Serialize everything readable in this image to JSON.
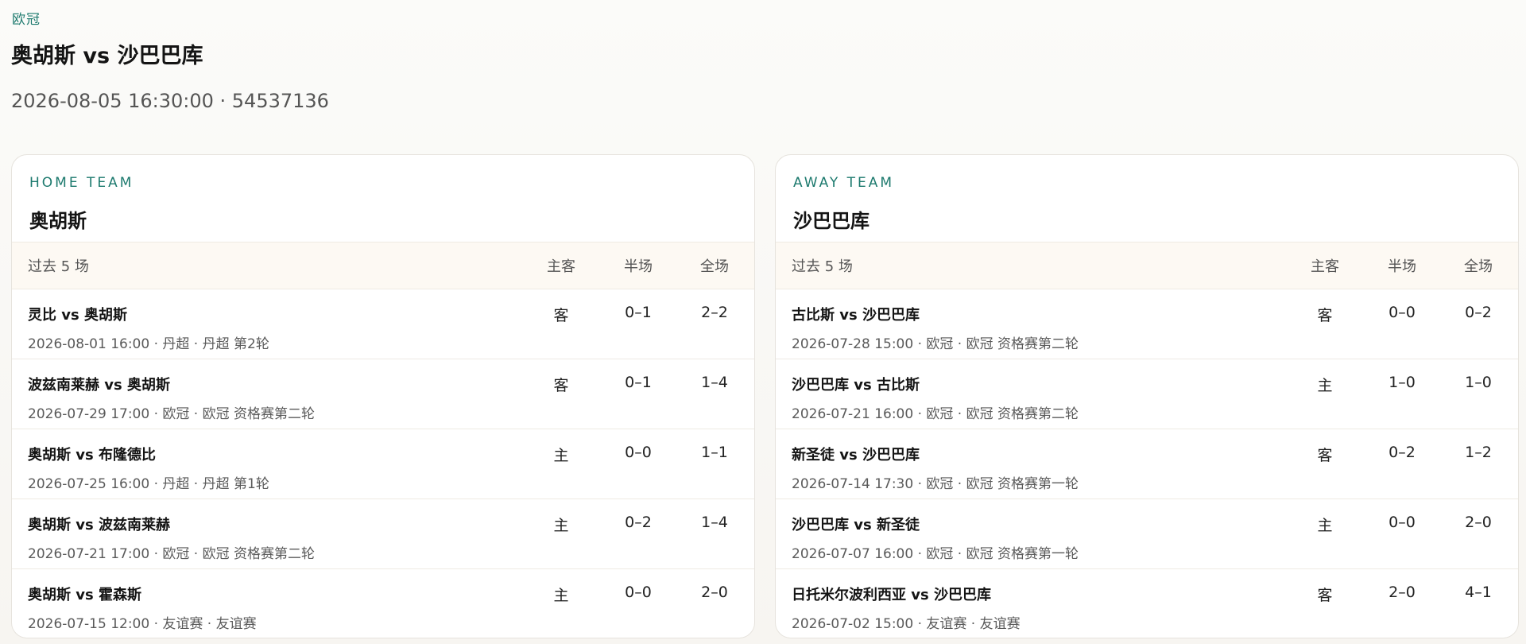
{
  "league": "欧冠",
  "match": {
    "title": "奥胡斯 vs 沙巴巴库",
    "meta": "2026-08-05 16:30:00 · 54537136"
  },
  "columns": {
    "title": "过去 5 场",
    "ha": "主客",
    "half": "半场",
    "full": "全场"
  },
  "home": {
    "role": "HOME TEAM",
    "name": "奥胡斯",
    "rows": [
      {
        "title": "灵比 vs 奥胡斯",
        "sub": "2026-08-01 16:00 · 丹超 · 丹超 第2轮",
        "ha": "客",
        "half": "0–1",
        "full": "2–2"
      },
      {
        "title": "波兹南莱赫 vs 奥胡斯",
        "sub": "2026-07-29 17:00 · 欧冠 · 欧冠 资格赛第二轮",
        "ha": "客",
        "half": "0–1",
        "full": "1–4"
      },
      {
        "title": "奥胡斯 vs 布隆德比",
        "sub": "2026-07-25 16:00 · 丹超 · 丹超 第1轮",
        "ha": "主",
        "half": "0–0",
        "full": "1–1"
      },
      {
        "title": "奥胡斯 vs 波兹南莱赫",
        "sub": "2026-07-21 17:00 · 欧冠 · 欧冠 资格赛第二轮",
        "ha": "主",
        "half": "0–2",
        "full": "1–4"
      },
      {
        "title": "奥胡斯 vs 霍森斯",
        "sub": "2026-07-15 12:00 · 友谊赛 · 友谊赛",
        "ha": "主",
        "half": "0–0",
        "full": "2–0"
      }
    ]
  },
  "away": {
    "role": "AWAY TEAM",
    "name": "沙巴巴库",
    "rows": [
      {
        "title": "古比斯 vs 沙巴巴库",
        "sub": "2026-07-28 15:00 · 欧冠 · 欧冠 资格赛第二轮",
        "ha": "客",
        "half": "0–0",
        "full": "0–2"
      },
      {
        "title": "沙巴巴库 vs 古比斯",
        "sub": "2026-07-21 16:00 · 欧冠 · 欧冠 资格赛第二轮",
        "ha": "主",
        "half": "1–0",
        "full": "1–0"
      },
      {
        "title": "新圣徒 vs 沙巴巴库",
        "sub": "2026-07-14 17:30 · 欧冠 · 欧冠 资格赛第一轮",
        "ha": "客",
        "half": "0–2",
        "full": "1–2"
      },
      {
        "title": "沙巴巴库 vs 新圣徒",
        "sub": "2026-07-07 16:00 · 欧冠 · 欧冠 资格赛第一轮",
        "ha": "主",
        "half": "0–0",
        "full": "2–0"
      },
      {
        "title": "日托米尔波利西亚 vs 沙巴巴库",
        "sub": "2026-07-02 15:00 · 友谊赛 · 友谊赛",
        "ha": "客",
        "half": "2–0",
        "full": "4–1"
      }
    ]
  }
}
